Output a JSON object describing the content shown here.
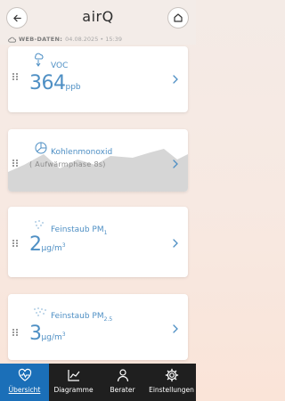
{
  "header": {
    "title": "airQ",
    "back_icon": "arrow-left-icon",
    "home_icon": "home-icon"
  },
  "web_data": {
    "label": "WEB-DATEN:",
    "timestamp": "04.08.2025 • 15:39",
    "icon": "cloud-icon"
  },
  "cards": [
    {
      "title": "VOC",
      "value": "364",
      "unit": "ppb",
      "icon": "voc-icon"
    },
    {
      "title": "Kohlenmonoxid",
      "subtitle": "( Aufwärmphase 8s)",
      "icon": "co-gauge-icon"
    },
    {
      "title": "Feinstaub PM",
      "title_sub": "1",
      "value": "2",
      "unit_main": "µg/m",
      "unit_sup": "3",
      "icon": "particles-icon"
    },
    {
      "title": "Feinstaub PM",
      "title_sub": "2.5",
      "value": "3",
      "unit_main": "µg/m",
      "unit_sup": "3",
      "icon": "particles-icon"
    }
  ],
  "tabs": [
    {
      "label": "Übersicht",
      "icon": "heart-pulse-icon",
      "active": true
    },
    {
      "label": "Diagramme",
      "icon": "chart-icon",
      "active": false
    },
    {
      "label": "Berater",
      "icon": "person-icon",
      "active": false
    },
    {
      "label": "Einstellungen",
      "icon": "gear-icon",
      "active": false
    }
  ],
  "colors": {
    "accent": "#4e8fc4",
    "tab_active": "#1b6fb8",
    "tab_bar": "#1f1f1f",
    "background": "#f7e9e2"
  }
}
